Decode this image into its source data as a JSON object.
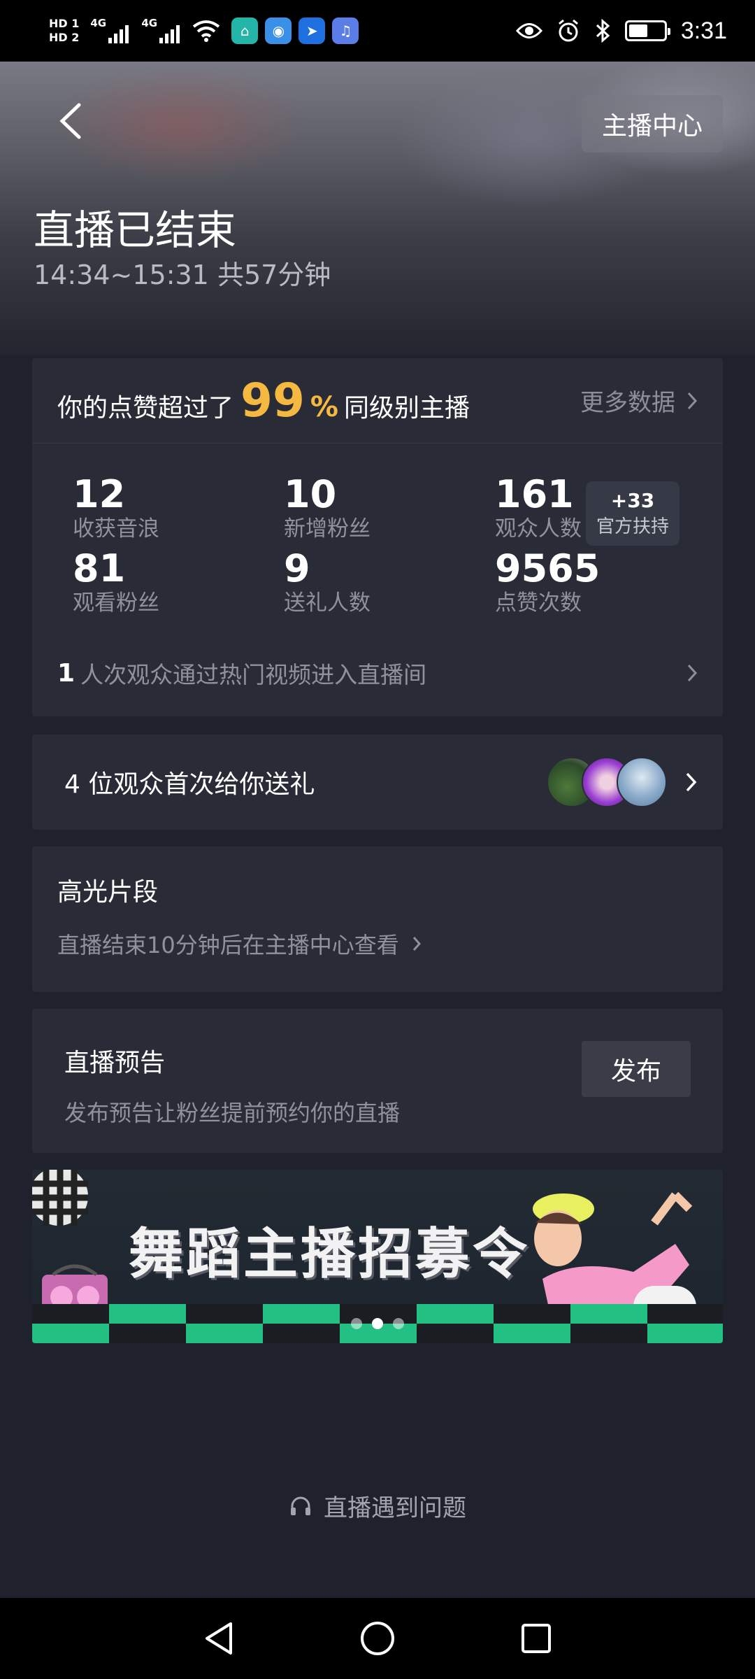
{
  "status_bar": {
    "hd1": "HD 1",
    "hd2": "HD 2",
    "net1": "4G",
    "net2": "4G",
    "time": "3:31",
    "app_icons": [
      "home-app-icon",
      "browser-app-icon",
      "nav-app-icon",
      "music-app-icon"
    ]
  },
  "header": {
    "anchor_center": "主播中心",
    "title": "直播已结束",
    "subtitle": "14:34~15:31 共57分钟"
  },
  "stats": {
    "likes_prefix": "你的点赞超过了",
    "likes_percent": "99",
    "percent_sign": "%",
    "likes_suffix": "同级别主播",
    "more_data": "更多数据",
    "items": [
      {
        "value": "12",
        "label": "收获音浪"
      },
      {
        "value": "10",
        "label": "新增粉丝"
      },
      {
        "value": "161",
        "label": "观众人数"
      },
      {
        "value": "81",
        "label": "观看粉丝"
      },
      {
        "value": "9",
        "label": "送礼人数"
      },
      {
        "value": "9565",
        "label": "点赞次数"
      }
    ],
    "badge_value": "+33",
    "badge_label": "官方扶持",
    "hot_count": "1",
    "hot_text": "人次观众通过热门视频进入直播间"
  },
  "gift": {
    "text": "4 位观众首次给你送礼"
  },
  "highlight": {
    "title": "高光片段",
    "subtitle": "直播结束10分钟后在主播中心查看"
  },
  "preview": {
    "title": "直播预告",
    "subtitle": "发布预告让粉丝提前预约你的直播",
    "publish": "发布"
  },
  "banner": {
    "title": "舞蹈主播招募令",
    "pages": 3,
    "active_page": 2
  },
  "footer": {
    "issue": "直播遇到问题"
  },
  "colors": {
    "background": "#1f222c",
    "card": "#292c37",
    "accent": "#f5b840",
    "muted_text": "#8f929c"
  }
}
